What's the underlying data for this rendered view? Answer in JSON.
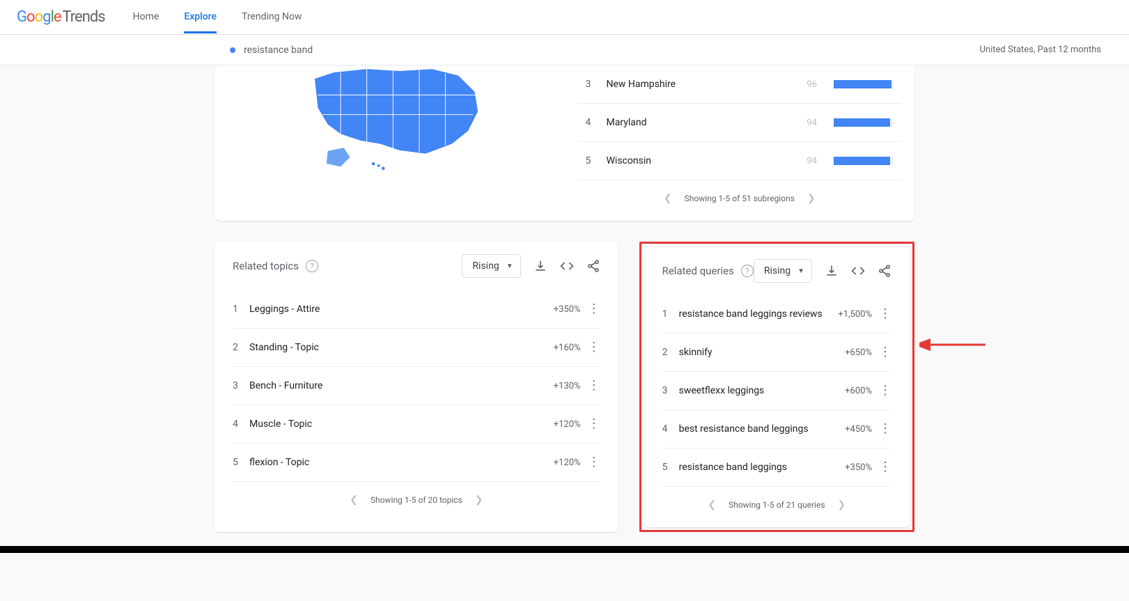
{
  "logo": {
    "trends": "Trends"
  },
  "nav": {
    "home": "Home",
    "explore": "Explore",
    "trending": "Trending Now"
  },
  "termbar": {
    "term": "resistance band",
    "context": "United States, Past 12 months"
  },
  "regions": {
    "rows": [
      {
        "rank": "3",
        "name": "New Hampshire",
        "value": "96",
        "pct": 96
      },
      {
        "rank": "4",
        "name": "Maryland",
        "value": "94",
        "pct": 94
      },
      {
        "rank": "5",
        "name": "Wisconsin",
        "value": "94",
        "pct": 94
      }
    ],
    "pager": "Showing 1-5 of 51 subregions"
  },
  "topics": {
    "title": "Related topics",
    "dropdown": "Rising",
    "rows": [
      {
        "rank": "1",
        "name": "Leggings - Attire",
        "value": "+350%"
      },
      {
        "rank": "2",
        "name": "Standing - Topic",
        "value": "+160%"
      },
      {
        "rank": "3",
        "name": "Bench - Furniture",
        "value": "+130%"
      },
      {
        "rank": "4",
        "name": "Muscle - Topic",
        "value": "+120%"
      },
      {
        "rank": "5",
        "name": "flexion - Topic",
        "value": "+120%"
      }
    ],
    "pager": "Showing 1-5 of 20 topics"
  },
  "queries": {
    "title": "Related queries",
    "dropdown": "Rising",
    "rows": [
      {
        "rank": "1",
        "name": "resistance band leggings reviews",
        "value": "+1,500%"
      },
      {
        "rank": "2",
        "name": "skinnify",
        "value": "+650%"
      },
      {
        "rank": "3",
        "name": "sweetflexx leggings",
        "value": "+600%"
      },
      {
        "rank": "4",
        "name": "best resistance band leggings",
        "value": "+450%"
      },
      {
        "rank": "5",
        "name": "resistance band leggings",
        "value": "+350%"
      }
    ],
    "pager": "Showing 1-5 of 21 queries"
  }
}
